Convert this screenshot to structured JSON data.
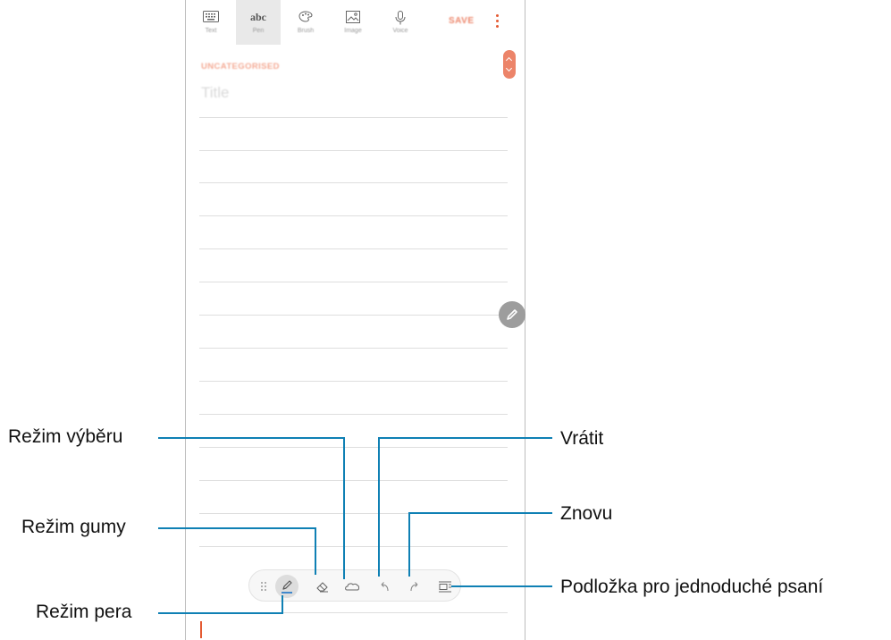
{
  "toolbar": {
    "tools": [
      {
        "label": "Text",
        "icon": "keyboard-icon"
      },
      {
        "label": "Pen",
        "icon": "handwriting-icon",
        "glyph": "abc",
        "active": true
      },
      {
        "label": "Brush",
        "icon": "palette-icon"
      },
      {
        "label": "Image",
        "icon": "image-icon"
      },
      {
        "label": "Voice",
        "icon": "microphone-icon"
      }
    ],
    "save_label": "SAVE",
    "more_icon": "more-vert-icon"
  },
  "note": {
    "category": "UNCATEGORISED",
    "title_placeholder": "Title"
  },
  "pen_toolbar": {
    "items": [
      "drag-handle-icon",
      "pen-icon",
      "eraser-icon",
      "lasso-select-icon",
      "undo-icon",
      "redo-icon",
      "easy-writing-pad-icon"
    ]
  },
  "callouts": {
    "selection_mode": "Režim výběru",
    "eraser_mode": "Režim gumy",
    "pen_mode": "Režim pera",
    "undo": "Vrátit",
    "redo": "Znovu",
    "easy_writing_pad": "Podložka pro jednoduché psaní"
  },
  "colors": {
    "accent": "#e45a32",
    "leader": "#0f80b4"
  }
}
